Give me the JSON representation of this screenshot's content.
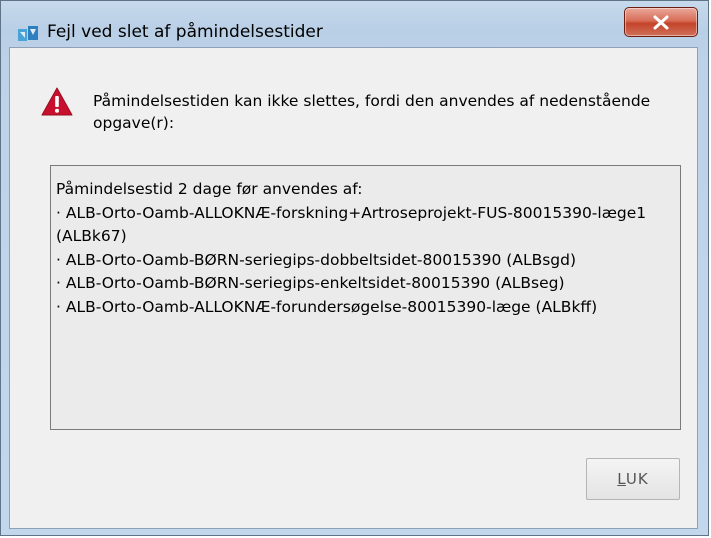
{
  "window": {
    "title": "Fejl ved slet af påmindelsestider"
  },
  "message": {
    "text": "Påmindelsestiden kan ikke slettes, fordi den anvendes af nedenstående opgave(r):"
  },
  "details": {
    "header": "Påmindelsestid 2 dage før anvendes af:",
    "items": [
      "· ALB-Orto-Oamb-ALLOKNÆ-forskning+Artroseprojekt-FUS-80015390-læge1 (ALBk67)",
      "· ALB-Orto-Oamb-BØRN-seriegips-dobbeltsidet-80015390 (ALBsgd)",
      "· ALB-Orto-Oamb-BØRN-seriegips-enkeltsidet-80015390 (ALBseg)",
      "· ALB-Orto-Oamb-ALLOKNÆ-forundersøgelse-80015390-læge (ALBkff)"
    ]
  },
  "buttons": {
    "close_label_mnemonic": "L",
    "close_label_rest": "UK"
  },
  "colors": {
    "title_bg": "#bdd2e8",
    "close_button": "#c4442a",
    "warning_icon": "#c8102e",
    "client_bg": "#f0f0f0",
    "details_bg": "#ebebeb"
  },
  "icons": {
    "app": "app-icon",
    "close": "close-icon",
    "warning": "warning-icon"
  }
}
